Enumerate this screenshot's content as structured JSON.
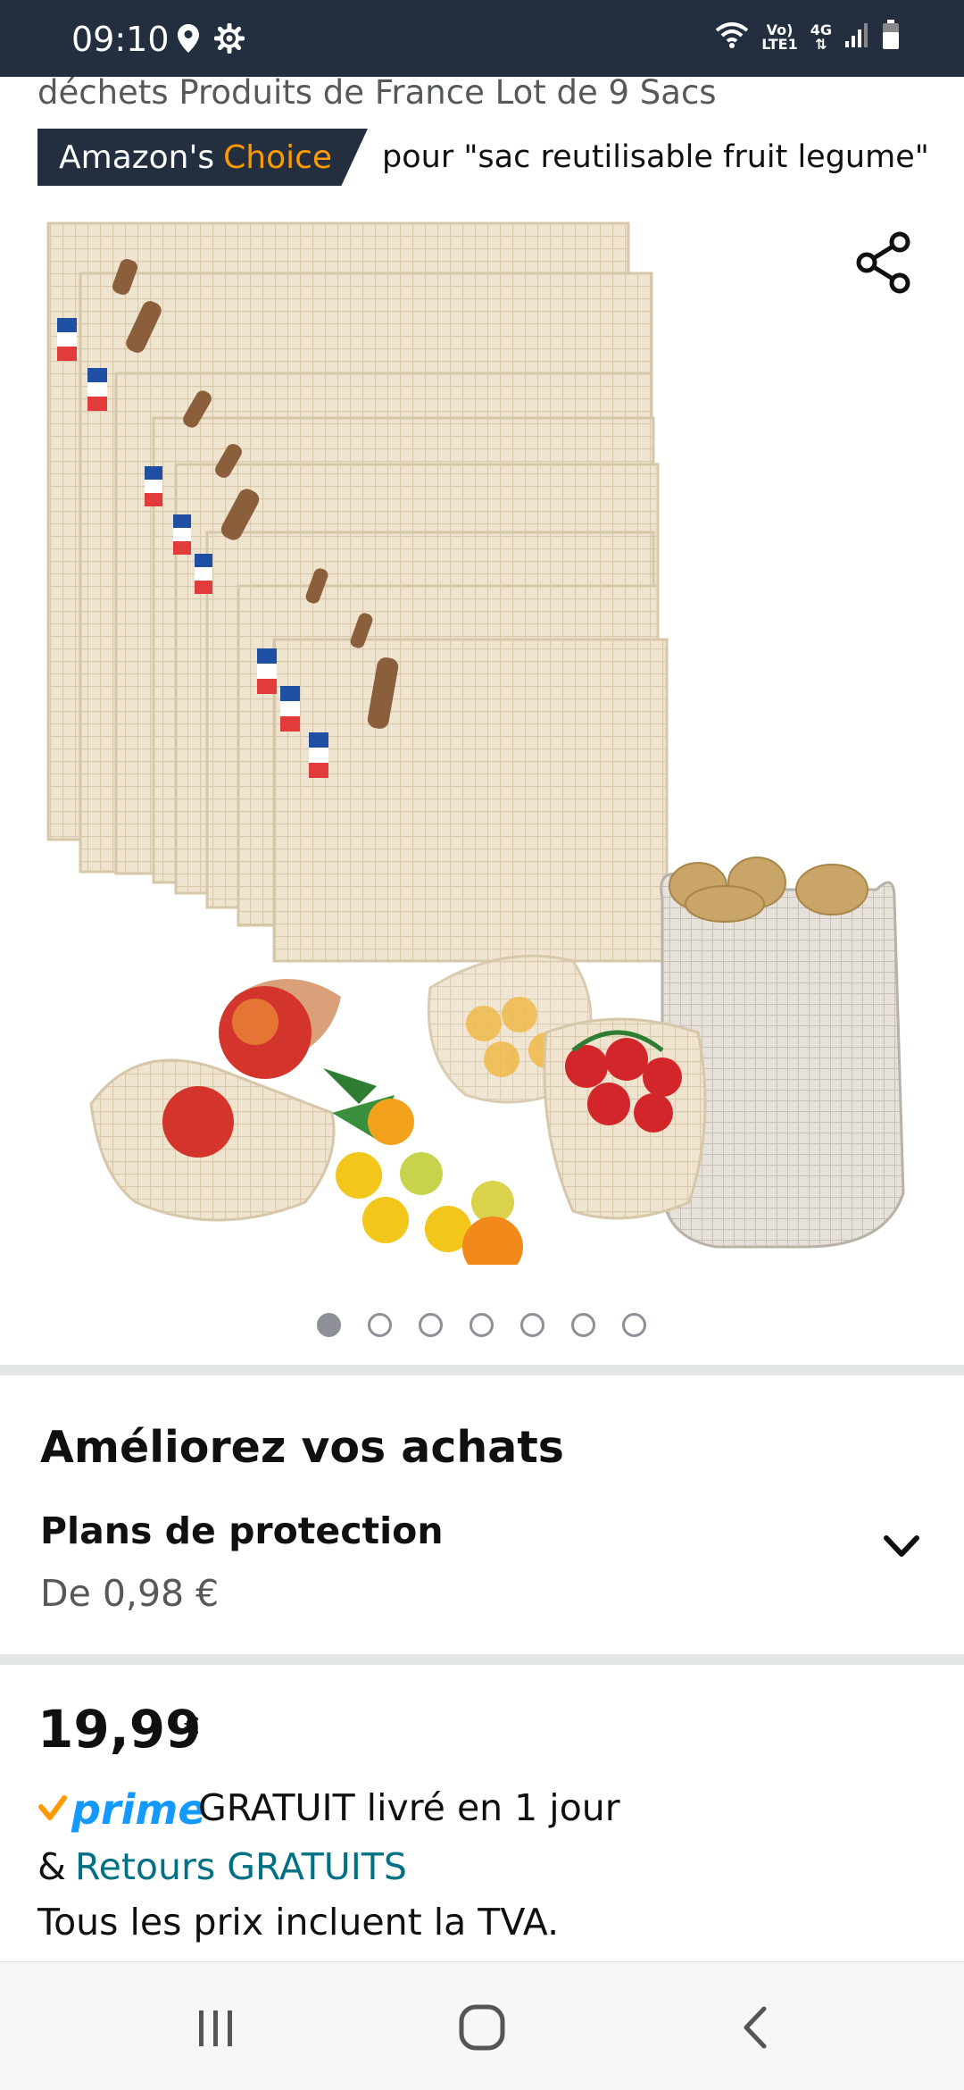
{
  "status_bar": {
    "time": "09:10",
    "network_vol": "Vo)",
    "network_lte": "LTE1",
    "network_4g": "4G",
    "icons": [
      "location-icon",
      "settings-icon",
      "wifi-icon",
      "signal-icon",
      "battery-icon"
    ]
  },
  "product": {
    "title_partial": "déchets Produits de France Lot de 9 Sacs",
    "badge_amazon": "Amazon's",
    "badge_choice": "Choice",
    "badge_query": "pour \"sac reutilisable fruit legume\"",
    "image_count": 7,
    "active_image_index": 0
  },
  "upgrade": {
    "title": "Améliorez vos achats",
    "plans_title": "Plans de protection",
    "plans_price": "De 0,98 €"
  },
  "pricing": {
    "price": "19,99",
    "currency": "€",
    "prime_label": "prime",
    "delivery": "GRATUIT livré en 1 jour",
    "returns_prefix": "&",
    "returns_link": "Retours GRATUITS",
    "tva_note": "Tous les prix incluent la TVA."
  },
  "colors": {
    "header_bg": "#232f3e",
    "choice_orange": "#ff9900",
    "prime_blue": "#1399ff",
    "link_teal": "#007185"
  }
}
